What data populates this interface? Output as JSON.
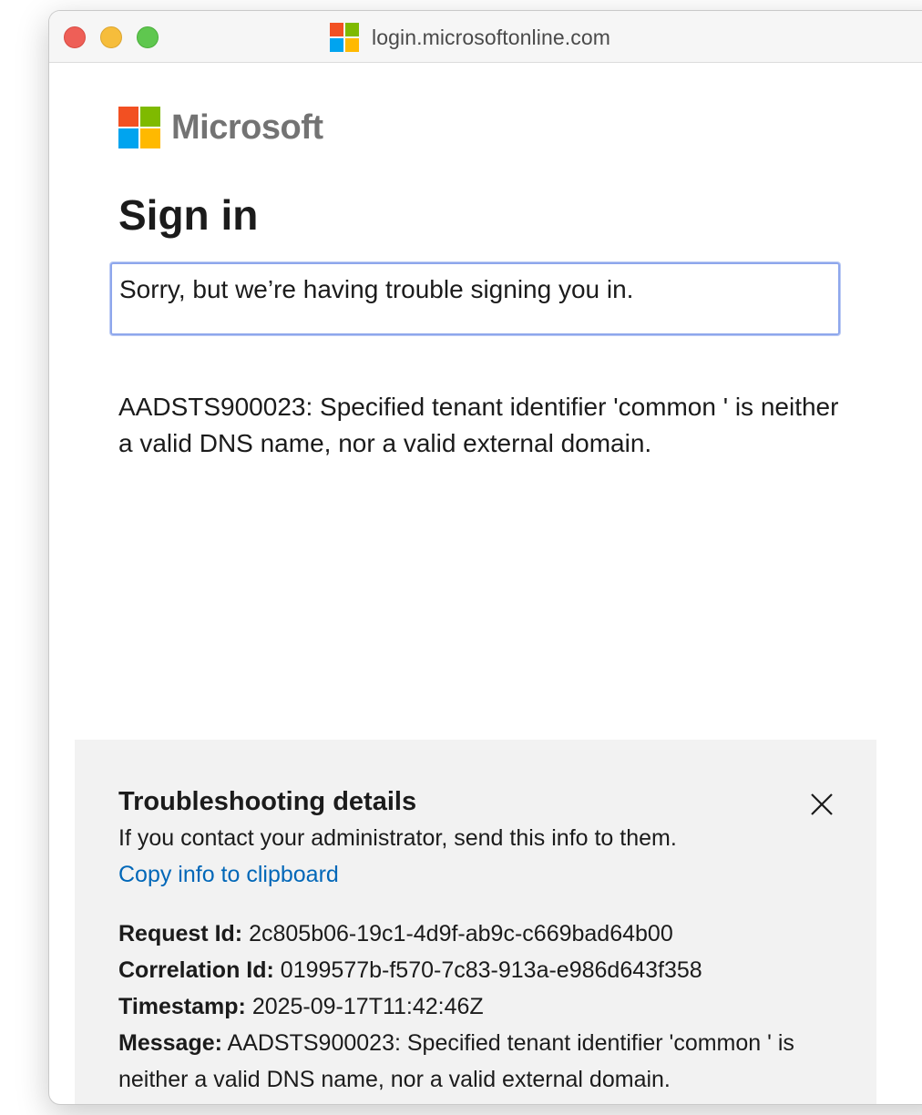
{
  "browser": {
    "url": "login.microsoftonline.com"
  },
  "brand": {
    "name": "Microsoft",
    "colors": {
      "red": "#f25022",
      "green": "#7fba00",
      "blue": "#00a4ef",
      "yellow": "#ffb900"
    }
  },
  "page": {
    "title": "Sign in",
    "error_banner": "Sorry, but we’re having trouble signing you in.",
    "error_message": "AADSTS900023: Specified tenant identifier 'common ' is neither a valid DNS name, nor a valid external domain."
  },
  "troubleshooting": {
    "title": "Troubleshooting details",
    "subtitle": "If you contact your administrator, send this info to them.",
    "copy_link": "Copy info to clipboard",
    "close_icon": "close-icon",
    "details": [
      {
        "key": "Request Id:",
        "value": "2c805b06-19c1-4d9f-ab9c-c669bad64b00"
      },
      {
        "key": "Correlation Id:",
        "value": "0199577b-f570-7c83-913a-e986d643f358"
      },
      {
        "key": "Timestamp:",
        "value": "2025-09-17T11:42:46Z"
      },
      {
        "key": "Message:",
        "value": "AADSTS900023: Specified tenant identifier 'common ' is neither a valid DNS name, nor a valid external domain."
      }
    ]
  }
}
